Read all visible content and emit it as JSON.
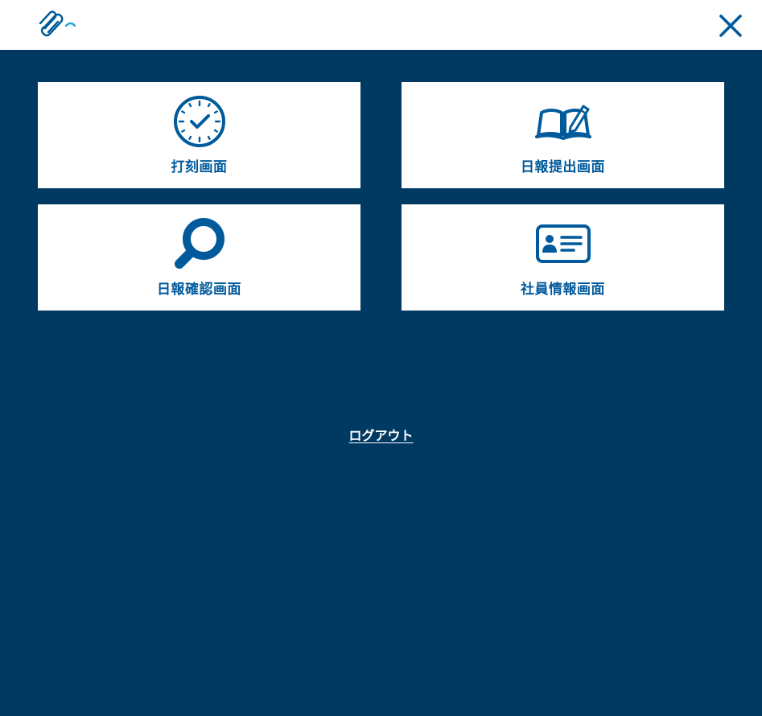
{
  "header": {
    "logo_icon": "paperclip-logo-icon",
    "close_icon": "close-icon"
  },
  "menu": {
    "items": [
      {
        "label": "打刻画面",
        "icon": "clock-icon"
      },
      {
        "label": "日報提出画面",
        "icon": "book-pencil-icon"
      },
      {
        "label": "日報確認画面",
        "icon": "search-icon"
      },
      {
        "label": "社員情報画面",
        "icon": "id-card-icon"
      }
    ]
  },
  "logout_label": "ログアウト",
  "colors": {
    "background": "#003a63",
    "accent": "#005a9c",
    "logo_accent": "#1fa3d9",
    "card": "#ffffff"
  }
}
